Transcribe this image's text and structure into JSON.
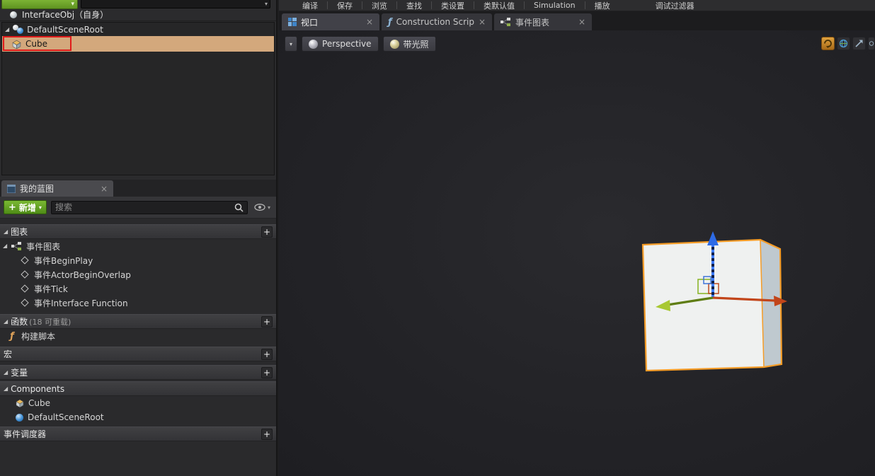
{
  "glyphs": {
    "close": "×",
    "dropdown": "▾",
    "expand": "◢",
    "plus": "+"
  },
  "components_panel": {
    "interface_label": "InterfaceObj（自身）",
    "root_item": "DefaultSceneRoot",
    "selected_item": "Cube"
  },
  "my_blueprint": {
    "tab_label": "我的蓝图",
    "add_new_label": "新增",
    "search_placeholder": "搜索",
    "sections": {
      "graphs": {
        "label": "图表"
      },
      "event_graph": {
        "label": "事件图表",
        "events": [
          "事件BeginPlay",
          "事件ActorBeginOverlap",
          "事件Tick",
          "事件Interface Function"
        ]
      },
      "functions": {
        "label": "函数",
        "count_suffix": "(18 可重载)",
        "rows": [
          "构建脚本"
        ]
      },
      "macros": {
        "label": "宏"
      },
      "variables": {
        "label": "变量"
      },
      "components": {
        "label": "Components",
        "rows": [
          "Cube",
          "DefaultSceneRoot"
        ]
      },
      "dispatchers": {
        "label": "事件调度器"
      }
    }
  },
  "toolbar": {
    "items": [
      "编译",
      "保存",
      "浏览",
      "查找",
      "类设置",
      "类默认值",
      "Simulation",
      "播放",
      "调试过滤器"
    ]
  },
  "doc_tabs": [
    {
      "label": "视口",
      "active": true
    },
    {
      "label": "Construction Scrip",
      "active": false
    },
    {
      "label": "事件图表",
      "active": false
    }
  ],
  "viewport": {
    "perspective_label": "Perspective",
    "lit_label": "带光照",
    "colors": {
      "selection_outline": "#F59C27",
      "cube_front": "#EFF1F0",
      "cube_side": "#BFC9CF",
      "axis_x": "#C2451A",
      "axis_x_head": "#C2451A",
      "axis_y": "#5F7D14",
      "axis_y_head": "#A8C832",
      "axis_z": "#3F7DFF",
      "axis_z_head": "#2E6BE6"
    }
  }
}
